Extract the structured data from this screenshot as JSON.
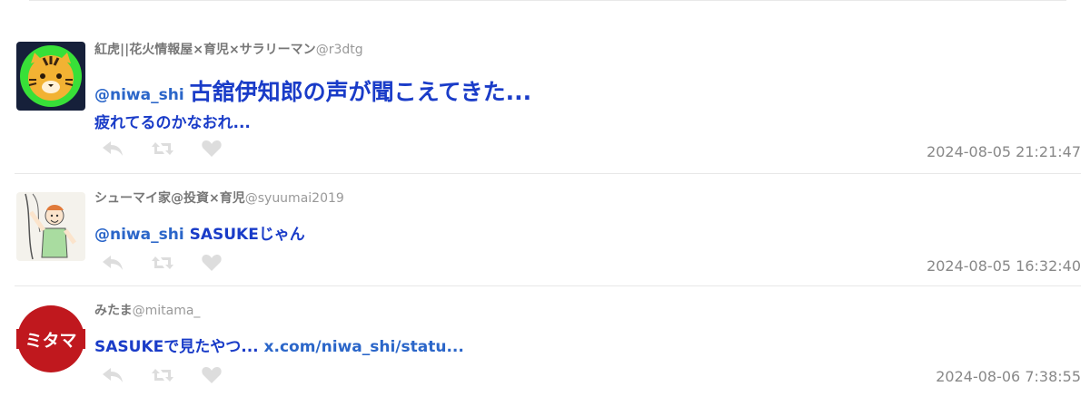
{
  "tweets": [
    {
      "display_name": "紅虎||花火情報屋×育児×サラリーマン",
      "screen_name": "@r3dtg",
      "mention": "@niwa_shi",
      "text_large": "古舘伊知郎の声が聞こえてきた...",
      "text_line2": "疲れてるのかなおれ...",
      "timestamp": "2024-08-05 21:21:47",
      "avatar_icon": "tiger-face"
    },
    {
      "display_name": "シューマイ家@投資×育児",
      "screen_name": "@syuumai2019",
      "mention": "@niwa_shi",
      "text_bold": "SASUKE",
      "text_rest": "じゃん",
      "timestamp": "2024-08-05 16:32:40",
      "avatar_icon": "climbing-person"
    },
    {
      "display_name": "みたま",
      "screen_name": "@mitama_",
      "text_main": "SASUKEで見たやつ...",
      "link": "x.com/niwa_shi/statu...",
      "timestamp": "2024-08-06 7:38:55",
      "avatar_icon": "mitama-logo",
      "avatar_logo_text": "ミタマ"
    }
  ],
  "actions": {
    "reply_icon": "reply-icon",
    "retweet_icon": "retweet-icon",
    "like_icon": "heart-icon",
    "icon_color": "#dddddd"
  },
  "colors": {
    "tweet_text": "#1a3cc8",
    "link": "#2b66c9",
    "timestamp": "#888888"
  }
}
